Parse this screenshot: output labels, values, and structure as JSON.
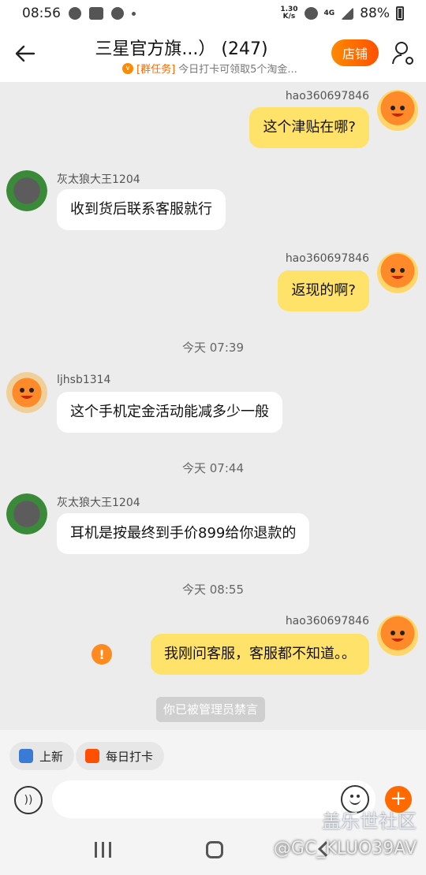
{
  "status_bar": {
    "time": "08:56",
    "net_speed_value": "1.30",
    "net_speed_unit": "K/s",
    "network": "4G",
    "battery": "88%"
  },
  "header": {
    "title": "三星官方旗...） (247)",
    "subtitle_tag": "[群任务]",
    "subtitle_text": "今日打卡可领取5个淘金...",
    "shop_label": "店铺"
  },
  "messages": [
    {
      "side": "mine",
      "sender": "hao360697846",
      "text": "这个津贴在哪?"
    },
    {
      "side": "theirs",
      "sender": "灰太狼大王1204",
      "text": "收到货后联系客服就行"
    },
    {
      "side": "mine",
      "sender": "hao360697846",
      "text": "返现的啊?"
    },
    {
      "type": "time",
      "text": "今天  07:39"
    },
    {
      "side": "theirs",
      "sender": "ljhsb1314",
      "text": "这个手机定金活动能减多少一般"
    },
    {
      "type": "time",
      "text": "今天  07:44"
    },
    {
      "side": "theirs",
      "sender": "灰太狼大王1204",
      "text": "耳机是按最终到手价899给你退款的"
    },
    {
      "type": "time",
      "text": "今天  08:55"
    },
    {
      "side": "mine",
      "sender": "hao360697846",
      "text": "我刚问客服，客服都不知道。。",
      "failed": true
    }
  ],
  "system_tip": "你已被管理员禁言",
  "tools": [
    {
      "label": "上新",
      "icon": "new-arrivals-icon",
      "color": "#3a7bd5"
    },
    {
      "label": "每日打卡",
      "icon": "calendar-checkin-icon",
      "color": "#ff5000"
    }
  ],
  "input": {
    "placeholder": "",
    "value": ""
  },
  "warn_glyph": "!",
  "plus_glyph": "+",
  "watermark": {
    "line1": "盖乐世社区",
    "line2": "@GC_KLUO39AV"
  },
  "colors": {
    "accent": "#ff5000",
    "my_bubble": "#ffe26a",
    "background": "#ececec"
  }
}
